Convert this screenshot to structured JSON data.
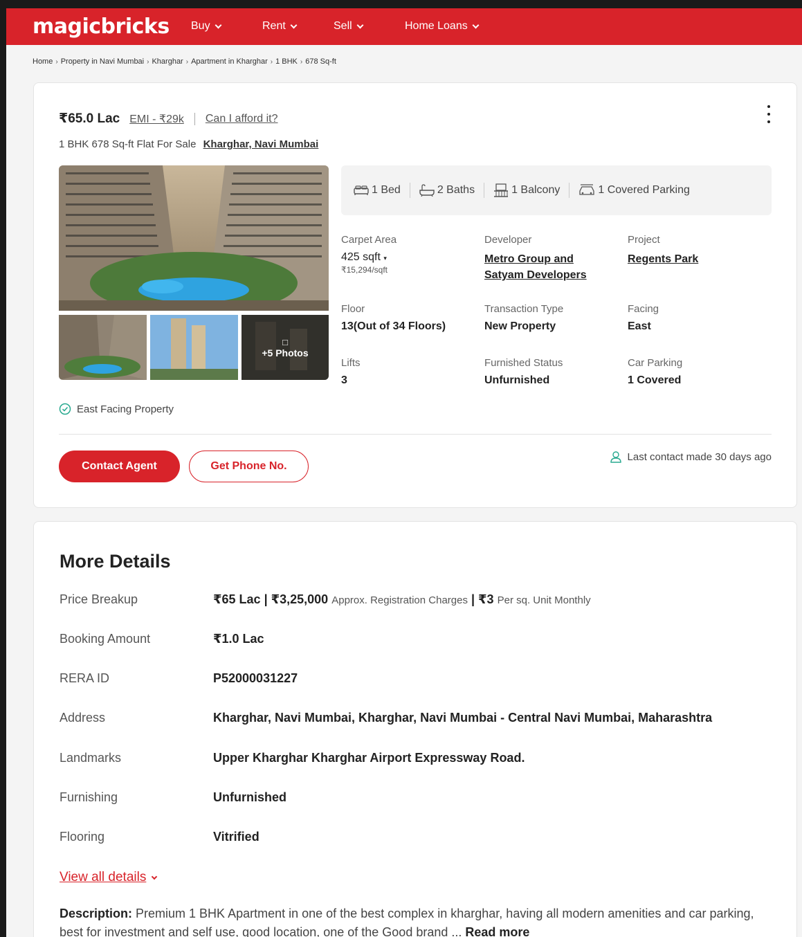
{
  "nav": {
    "logo": "magicbricks",
    "items": [
      {
        "label": "Buy"
      },
      {
        "label": "Rent"
      },
      {
        "label": "Sell"
      },
      {
        "label": "Home Loans"
      }
    ]
  },
  "breadcrumb": [
    "Home",
    "Property in Navi Mumbai",
    "Kharghar",
    "Apartment in Kharghar",
    "1 BHK",
    "678 Sq-ft"
  ],
  "listing": {
    "price": "₹65.0 Lac",
    "emi": "EMI - ₹29k",
    "afford": "Can I afford it?",
    "subtitle": "1 BHK 678 Sq-ft Flat For Sale",
    "location": "Kharghar, Navi Mumbai",
    "photos_more": "+5 Photos",
    "amenities": {
      "bed": "1 Bed",
      "baths": "2 Baths",
      "balcony": "1 Balcony",
      "parking": "1 Covered Parking"
    },
    "details": {
      "carpet_label": "Carpet Area",
      "carpet_value": "425 sqft",
      "carpet_rate": "₹15,294/sqft",
      "developer_label": "Developer",
      "developer_value_1": "Metro Group and",
      "developer_value_2": "Satyam Developers",
      "project_label": "Project",
      "project_value": "Regents Park",
      "floor_label": "Floor",
      "floor_value": "13(Out of 34 Floors)",
      "transaction_label": "Transaction Type",
      "transaction_value": "New Property",
      "facing_label": "Facing",
      "facing_value": "East",
      "lifts_label": "Lifts",
      "lifts_value": "3",
      "furnished_label": "Furnished Status",
      "furnished_value": "Unfurnished",
      "carparking_label": "Car Parking",
      "carparking_value": "1 Covered"
    },
    "facing_note": "East Facing Property",
    "contact_btn": "Contact Agent",
    "phone_btn": "Get Phone No.",
    "last_contact": "Last contact made 30 days ago"
  },
  "more_details": {
    "title": "More Details",
    "rows": [
      {
        "key": "Price Breakup",
        "value_a": "₹65 Lac | ₹3,25,000",
        "value_b": "Approx. Registration Charges",
        "value_c": "| ₹3",
        "value_d": "Per sq. Unit Monthly"
      },
      {
        "key": "Booking Amount",
        "value": "₹1.0 Lac"
      },
      {
        "key": "RERA ID",
        "value": "P52000031227"
      },
      {
        "key": "Address",
        "value": "Kharghar, Navi Mumbai, Kharghar, Navi Mumbai - Central Navi Mumbai, Maharashtra"
      },
      {
        "key": "Landmarks",
        "value": "Upper Kharghar Kharghar Airport Expressway Road."
      },
      {
        "key": "Furnishing",
        "value": "Unfurnished"
      },
      {
        "key": "Flooring",
        "value": "Vitrified"
      }
    ],
    "view_all": "View all details",
    "desc_label": "Description:",
    "desc_text": "Premium 1 BHK Apartment in one of the best complex in kharghar, having all modern amenities and car parking, best for investment and self use, good location, one of the Good brand ...",
    "read_more": "Read more"
  },
  "colors": {
    "brand": "#d8232a",
    "accent_green": "#27a98f"
  }
}
